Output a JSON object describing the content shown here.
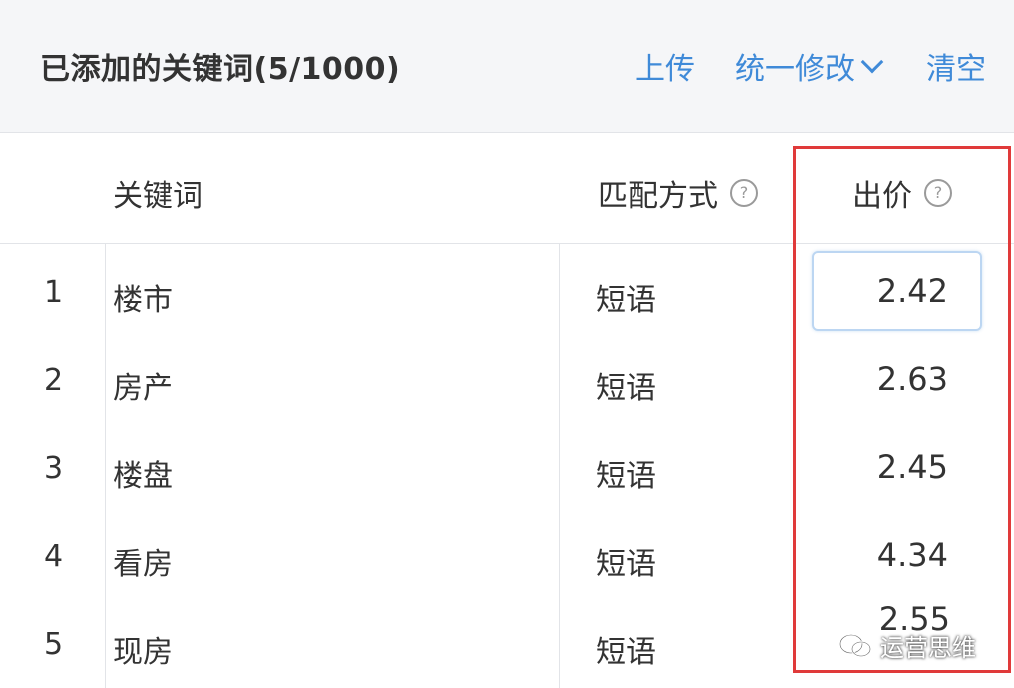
{
  "header": {
    "title": "已添加的关键词(5/1000)",
    "actions": {
      "upload": "上传",
      "batch_edit": "统一修改",
      "clear": "清空"
    }
  },
  "table": {
    "columns": {
      "keyword": "关键词",
      "match_type": "匹配方式",
      "bid": "出价"
    },
    "help_glyph": "?",
    "rows": [
      {
        "index": "1",
        "keyword": "楼市",
        "match_type": "短语",
        "bid": "2.42"
      },
      {
        "index": "2",
        "keyword": "房产",
        "match_type": "短语",
        "bid": "2.63"
      },
      {
        "index": "3",
        "keyword": "楼盘",
        "match_type": "短语",
        "bid": "2.45"
      },
      {
        "index": "4",
        "keyword": "看房",
        "match_type": "短语",
        "bid": "4.34"
      },
      {
        "index": "5",
        "keyword": "现房",
        "match_type": "短语",
        "bid": "2.55"
      }
    ]
  },
  "colors": {
    "link": "#3f8ad8",
    "highlight": "#e03a3a",
    "header_bg": "#f5f6f8"
  },
  "watermark": {
    "icon": "wechat-icon",
    "text": "运营思维"
  }
}
